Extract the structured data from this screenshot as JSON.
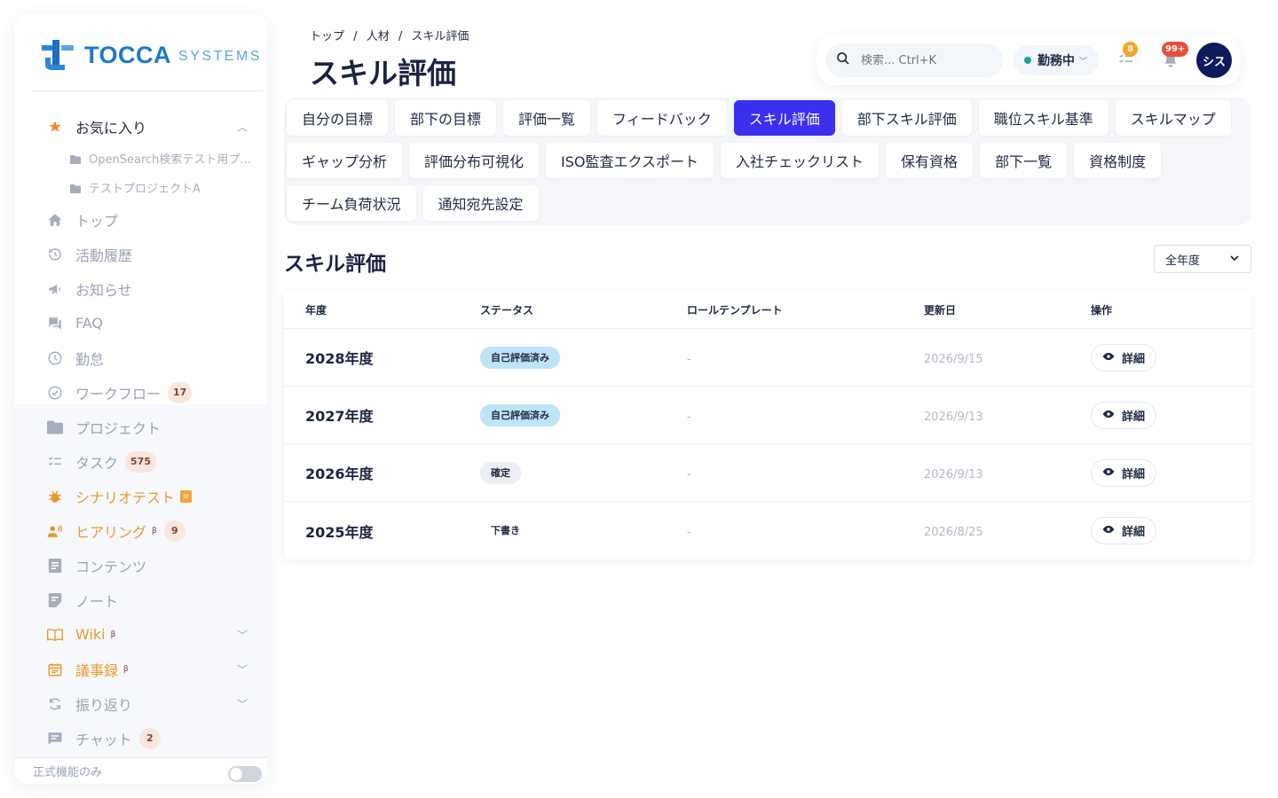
{
  "brand": {
    "name": "TOCCA",
    "sub": "SYSTEMS"
  },
  "sidebar": {
    "favorites": {
      "label": "お気に入り",
      "items": [
        "OpenSearch検索テスト用プ...",
        "テストプロジェクトA"
      ]
    },
    "items": [
      {
        "label": "トップ",
        "icon": "home-icon"
      },
      {
        "label": "活動履歴",
        "icon": "history-icon"
      },
      {
        "label": "お知らせ",
        "icon": "megaphone-icon"
      },
      {
        "label": "FAQ",
        "icon": "faq-icon"
      },
      {
        "label": "勤怠",
        "icon": "clock-icon"
      },
      {
        "label": "ワークフロー",
        "icon": "check-circle-icon",
        "badge": "17"
      },
      {
        "label": "プロジェクト",
        "icon": "folder-icon"
      },
      {
        "label": "タスク",
        "icon": "task-list-icon",
        "badge": "575"
      },
      {
        "label": "シナリオテスト",
        "icon": "bug-icon",
        "tag": "α"
      },
      {
        "label": "ヒアリング",
        "icon": "people-icon",
        "tag": "β",
        "badge": "9"
      },
      {
        "label": "コンテンツ",
        "icon": "document-icon"
      },
      {
        "label": "ノート",
        "icon": "note-icon"
      },
      {
        "label": "Wiki",
        "icon": "book-icon",
        "tag": "β"
      },
      {
        "label": "議事録",
        "icon": "calendar-icon",
        "tag": "β"
      },
      {
        "label": "振り返り",
        "icon": "refresh-icon"
      },
      {
        "label": "チャット",
        "icon": "chat-icon",
        "badge": "2"
      }
    ],
    "footer": "正式機能のみ"
  },
  "header": {
    "breadcrumb": [
      "トップ",
      "/",
      "人材",
      "/",
      "スキル評価"
    ],
    "title": "スキル評価",
    "search_placeholder": "検索... Ctrl+K",
    "status": "勤務中",
    "task_badge": "8",
    "notif_badge": "99+",
    "avatar": "シス",
    "colors": {
      "task_badge": "#f5a623",
      "notif_badge": "#e94e3c"
    }
  },
  "tabs": [
    "自分の目標",
    "部下の目標",
    "評価一覧",
    "フィードバック",
    "スキル評価",
    "部下スキル評価",
    "職位スキル基準",
    "スキルマップ",
    "ギャップ分析",
    "評価分布可視化",
    "ISO監査エクスポート",
    "入社チェックリスト",
    "保有資格",
    "部下一覧",
    "資格制度",
    "チーム負荷状況",
    "通知宛先設定"
  ],
  "active_tab": "スキル評価",
  "section": {
    "title": "スキル評価",
    "filter": "全年度"
  },
  "table": {
    "headers": [
      "年度",
      "ステータス",
      "ロールテンプレート",
      "更新日",
      "操作"
    ],
    "rows": [
      {
        "year": "2028年度",
        "status": "自己評価済み",
        "template": "-",
        "updated": "2026/9/15",
        "action": "詳細"
      },
      {
        "year": "2027年度",
        "status": "自己評価済み",
        "template": "-",
        "updated": "2026/9/13",
        "action": "詳細"
      },
      {
        "year": "2026年度",
        "status": "確定",
        "template": "-",
        "updated": "2026/9/13",
        "action": "詳細"
      },
      {
        "year": "2025年度",
        "status": "下書き",
        "template": "-",
        "updated": "2026/8/25",
        "action": "詳細"
      }
    ]
  },
  "accent_color": "#3b2ff0"
}
